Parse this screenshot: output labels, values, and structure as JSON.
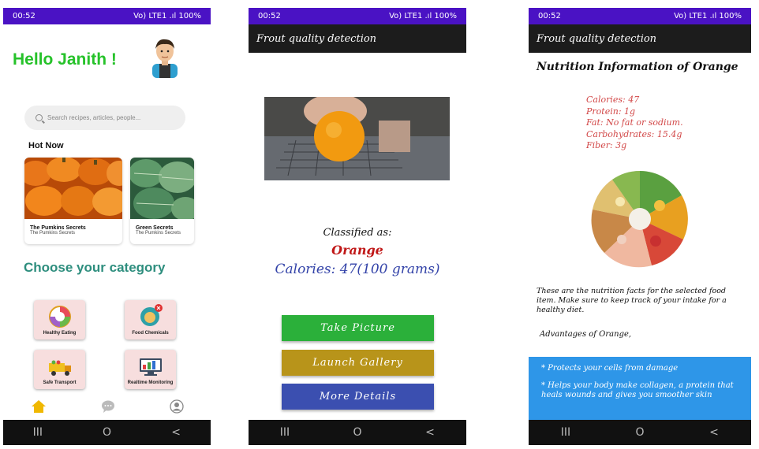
{
  "colors": {
    "statusbar": "#4a12c4",
    "greeting": "#26c22a",
    "category_title": "#2e8e7e",
    "take_picture": "#2bb03a",
    "launch_gallery": "#b8941a",
    "more_details": "#3b4fb0",
    "fruit_name": "#c01818",
    "calories": "#3242a8",
    "facts": "#d24848",
    "advantages_box": "#2e96e8",
    "home_tab": "#f0b800"
  },
  "status": {
    "time": "00:52",
    "right": "Vo) LTE1 .ıl 100%"
  },
  "screen1": {
    "greeting": "Hello Janith !",
    "search_placeholder": "Search recipes, articles, people...",
    "hot_now": "Hot Now",
    "cards": [
      {
        "title": "The Pumkins Secrets",
        "subtitle": "The Pumkins Secrets"
      },
      {
        "title": "Green Secrets",
        "subtitle": "The Pumkins Secrets"
      }
    ],
    "choose_category": "Choose your category",
    "categories": [
      {
        "label": "Healthy Eating",
        "icon": "healthy-eating-icon"
      },
      {
        "label": "Food Chemicals",
        "icon": "food-chemicals-icon"
      },
      {
        "label": "Safe Transport",
        "icon": "truck-icon"
      },
      {
        "label": "Realtime Monitoring",
        "icon": "monitor-icon"
      }
    ],
    "tabs": [
      {
        "icon": "home-icon"
      },
      {
        "icon": "chat-icon"
      },
      {
        "icon": "profile-icon"
      }
    ]
  },
  "screen2": {
    "app_title": "Frout quality detection",
    "classified_as": "Classified as:",
    "fruit": "Orange",
    "calories": "Calories: 47(100 grams)",
    "buttons": {
      "take_picture": "Take Picture",
      "launch_gallery": "Launch Gallery",
      "more_details": "More Details"
    }
  },
  "screen3": {
    "app_title": "Frout quality detection",
    "heading": "Nutrition Information of Orange",
    "facts": [
      "Calories: 47",
      "Protein: 1g",
      "Fat: No fat or sodium.",
      "Carbohydrates: 15.4g",
      "Fiber: 3g"
    ],
    "description": "These are the nutrition facts for the selected food item. Make sure to keep track of your intake for a healthy diet.",
    "advantages_title": "Advantages of Orange,",
    "advantages": [
      "* Protects your cells from damage",
      "* Helps your body make collagen, a protein that heals wounds and gives you smoother skin"
    ]
  },
  "navbar": {
    "recent": "III",
    "home": "O",
    "back": "<"
  }
}
